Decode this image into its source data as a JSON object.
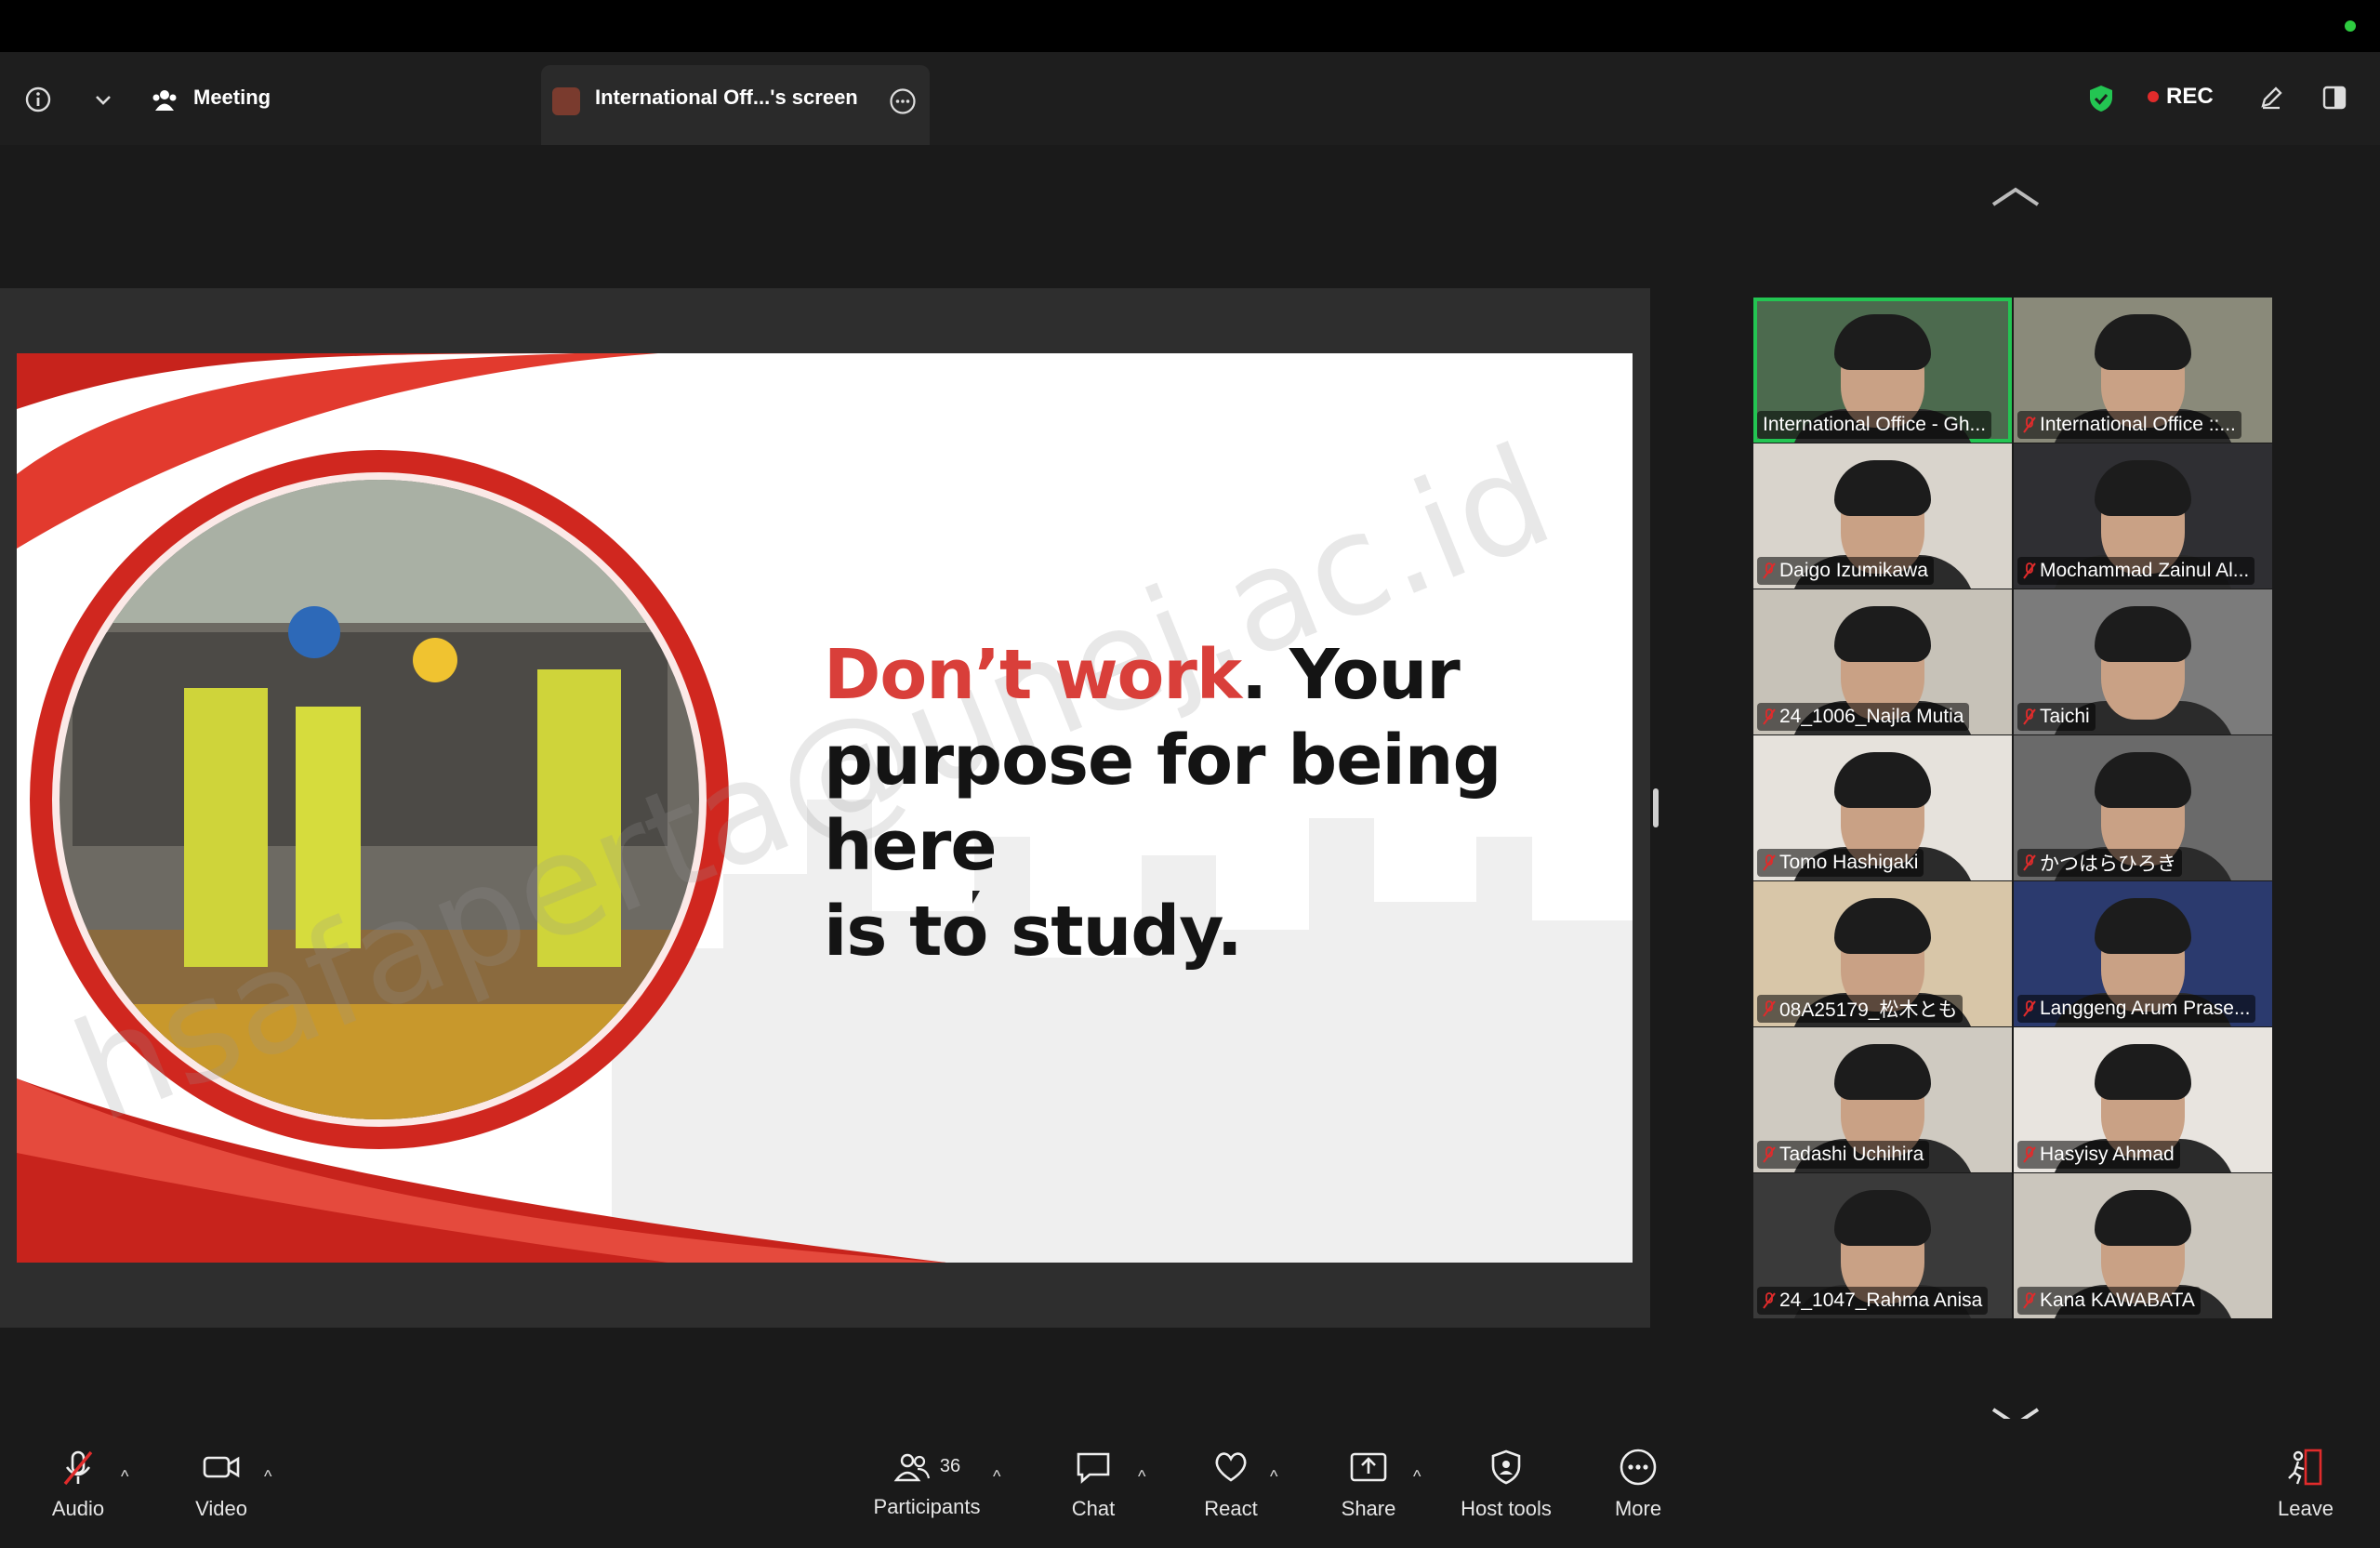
{
  "header": {
    "meeting_label": "Meeting",
    "share_tab_label": "International Off...'s screen",
    "rec_label": "REC"
  },
  "slide": {
    "text_red": "Don’t work",
    "text_rest_1": ". Your",
    "text_line_2": "purpose for being here",
    "text_line_3": "is to study.",
    "watermark": "hsafaperta@unej.ac.id"
  },
  "gallery": {
    "participants": [
      {
        "name": "International Office - Gh...",
        "muted": false,
        "active": true
      },
      {
        "name": "International Office ::...",
        "muted": true,
        "active": false
      },
      {
        "name": "Daigo Izumikawa",
        "muted": true,
        "active": false
      },
      {
        "name": "Mochammad Zainul Al...",
        "muted": true,
        "active": false
      },
      {
        "name": "24_1006_Najla Mutia",
        "muted": true,
        "active": false
      },
      {
        "name": "Taichi",
        "muted": true,
        "active": false
      },
      {
        "name": "Tomo Hashigaki",
        "muted": true,
        "active": false
      },
      {
        "name": "かつはらひろき",
        "muted": true,
        "active": false
      },
      {
        "name": "08A25179_松木とも",
        "muted": true,
        "active": false
      },
      {
        "name": "Langgeng Arum Prase...",
        "muted": true,
        "active": false
      },
      {
        "name": "Tadashi Uchihira",
        "muted": true,
        "active": false
      },
      {
        "name": "Hasyisy Ahmad",
        "muted": true,
        "active": false
      },
      {
        "name": "24_1047_Rahma Anisa",
        "muted": true,
        "active": false
      },
      {
        "name": "Kana KAWABATA",
        "muted": true,
        "active": false
      }
    ]
  },
  "toolbar": {
    "audio": "Audio",
    "video": "Video",
    "participants": "Participants",
    "participants_count": "36",
    "chat": "Chat",
    "react": "React",
    "share": "Share",
    "host_tools": "Host tools",
    "more": "More",
    "leave": "Leave"
  },
  "colors": {
    "accent_red": "#d93f3a",
    "active_speaker": "#23c552",
    "rec_dot": "#e02b2b"
  }
}
